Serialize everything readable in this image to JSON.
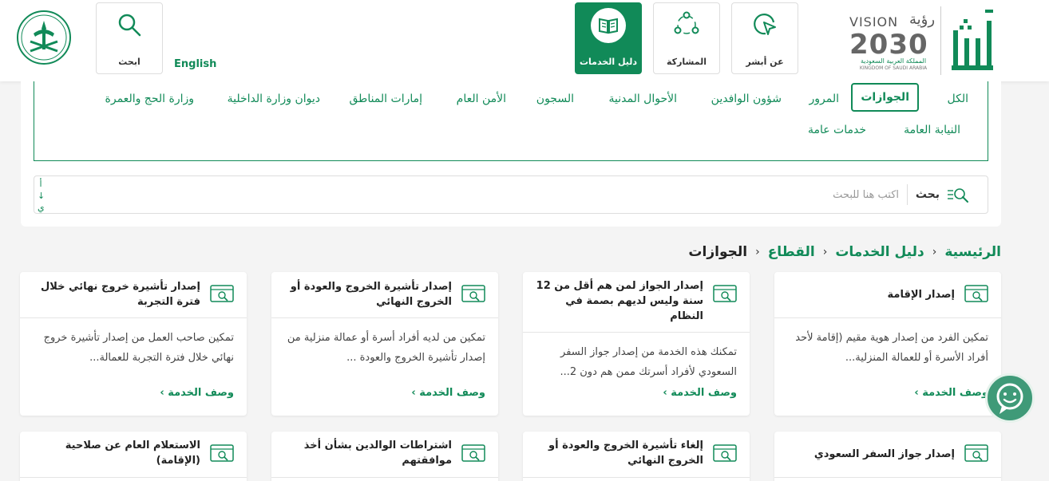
{
  "header": {
    "nav": [
      {
        "label": "عن أبشر",
        "icon": "pointer-icon"
      },
      {
        "label": "المشاركة",
        "icon": "share-icon"
      },
      {
        "label": "دليل الخدمات",
        "icon": "book-icon",
        "active": true
      },
      {
        "label": "ابحث",
        "icon": "search-icon"
      }
    ],
    "language": "English",
    "brand": {
      "vision_en": "VISION",
      "vision_ar": "رؤية",
      "vision_year": "2030",
      "kingdom_ar": "المملكة العربية السعودية",
      "kingdom_en": "KINGDOM OF SAUDI ARABIA",
      "absher": "أبشر"
    }
  },
  "sectors": {
    "tabs_row1": [
      "الكل",
      "الجوازات",
      "المرور",
      "شؤون الوافدين",
      "الأحوال المدنية",
      "السجون",
      "الأمن العام",
      "إمارات المناطق",
      "ديوان وزارة الداخلية",
      "وزارة الحج والعمرة"
    ],
    "tabs_row2": [
      "النيابة العامة",
      "خدمات عامة"
    ],
    "active": "الجوازات"
  },
  "search": {
    "label": "بحث",
    "placeholder": "اكتب هنا للبحث",
    "side_letters": [
      "أ",
      "↓",
      "ي"
    ]
  },
  "breadcrumb": [
    "الرئيسية",
    "دليل الخدمات",
    "القطاع",
    "الجوازات"
  ],
  "cards_row1": [
    {
      "title": "إصدار الإقامة",
      "desc": "تمكين الفرد من إصدار هوية مقيم (إقامة لأحد أفراد الأسرة أو للعمالة المنزلية...",
      "link": "وصف الخدمة ›"
    },
    {
      "title": "إصدار الجواز لمن هم أقل من 12 سنة وليس لديهم بصمة في النظام",
      "desc": "تمكنك هذه الخدمة من إصدار جواز السفر السعودي لأفراد أسرتك ممن هم دون 2...",
      "link": "وصف الخدمة ›"
    },
    {
      "title": "إصدار تأشيرة الخروج والعودة أو الخروج النهائي",
      "desc": "تمكين من لديه أفراد أسرة أو عمالة منزلية من إصدار تأشيرة الخروج والعودة ...",
      "link": "وصف الخدمة ›"
    },
    {
      "title": "إصدار تأشيرة خروج نهائي خلال فترة التجربة",
      "desc": "تمكين صاحب العمل من إصدار تأشيرة خروج نهائي خلال فترة التجربة للعمالة...",
      "link": "وصف الخدمة ›"
    }
  ],
  "cards_row2": [
    {
      "title": "إصدار جواز السفر السعودي"
    },
    {
      "title": "إلغاء تأشيرة الخروج والعودة أو الخروج النهائي"
    },
    {
      "title": "اشتراطات الوالدين بشأن أخذ موافقتهم"
    },
    {
      "title": "الاستعلام العام عن صلاحية (الإقامة)"
    }
  ],
  "colors": {
    "primary": "#118a58",
    "background": "#f4f4f4"
  }
}
